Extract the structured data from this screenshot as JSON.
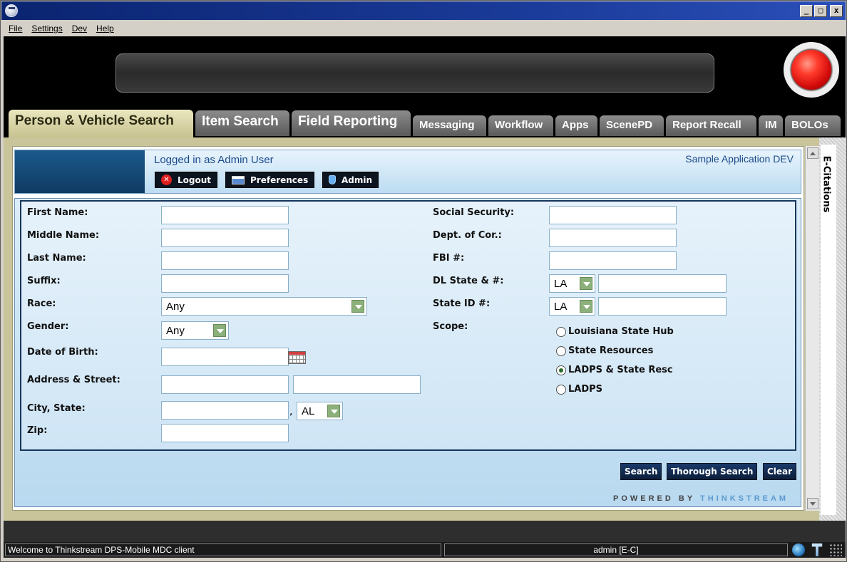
{
  "menu": [
    "File",
    "Settings",
    "Dev",
    "Help"
  ],
  "tabs": [
    {
      "label": "Person & Vehicle Search",
      "active": true
    },
    {
      "label": "Item Search"
    },
    {
      "label": "Field Reporting"
    },
    {
      "label": "Messaging"
    },
    {
      "label": "Workflow"
    },
    {
      "label": "Apps"
    },
    {
      "label": "ScenePD"
    },
    {
      "label": "Report Recall"
    },
    {
      "label": "IM"
    },
    {
      "label": "BOLOs"
    }
  ],
  "header": {
    "logged_in": "Logged in as Admin User",
    "app_name": "Sample Application DEV",
    "logout": "Logout",
    "preferences": "Preferences",
    "admin": "Admin"
  },
  "form": {
    "first_name": "First Name:",
    "middle_name": "Middle Name:",
    "last_name": "Last Name:",
    "suffix": "Suffix:",
    "race": "Race:",
    "race_value": "Any",
    "gender": "Gender:",
    "gender_value": "Any",
    "dob": "Date of Birth:",
    "address": "Address & Street:",
    "city_state": "City, State:",
    "state_value": "AL",
    "zip": "Zip:",
    "ssn": "Social Security:",
    "doc": "Dept. of Cor.:",
    "fbi": "FBI #:",
    "dl": "DL State & #:",
    "dl_state": "LA",
    "state_id": "State ID #:",
    "state_id_state": "LA",
    "scope": "Scope:",
    "scope_options": [
      {
        "label": "Louisiana State Hub",
        "selected": false
      },
      {
        "label": "State Resources",
        "selected": false
      },
      {
        "label": "LADPS & State Resc",
        "selected": true
      },
      {
        "label": "LADPS",
        "selected": false
      }
    ]
  },
  "actions": {
    "search": "Search",
    "thorough": "Thorough Search",
    "clear": "Clear"
  },
  "powered_by": "POWERED BY ",
  "powered_brand": "THINKSTREAM",
  "side_tab": "E-Citations",
  "status": {
    "message": "Welcome to Thinkstream DPS-Mobile MDC client",
    "user": "admin [E-C]"
  },
  "window_buttons": {
    "minimize": "_",
    "maximize": "□",
    "close": "x"
  }
}
